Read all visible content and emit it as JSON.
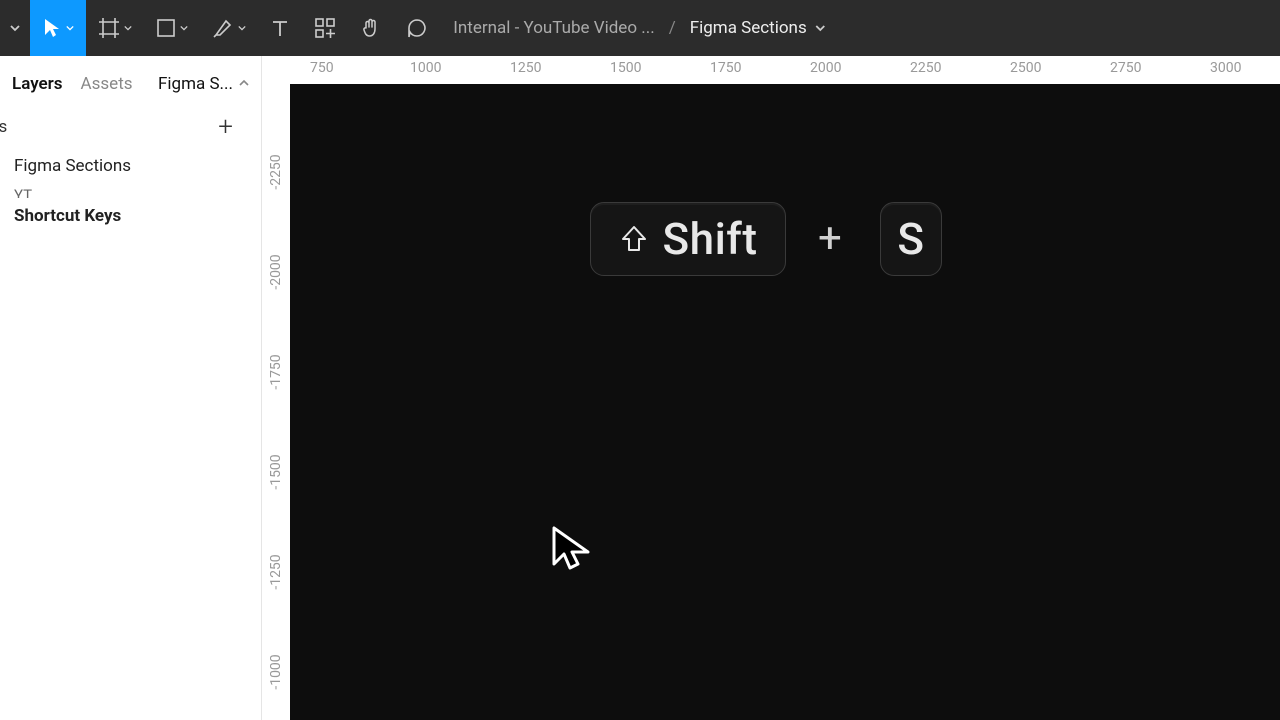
{
  "toolbar": {
    "breadcrumb_project": "Internal - YouTube Video ...",
    "breadcrumb_page": "Figma Sections"
  },
  "sidebar": {
    "tabs": {
      "layers": "Layers",
      "assets": "Assets",
      "page_short": "Figma S..."
    },
    "pages_label": "ges",
    "items": {
      "figma_sections": "Figma Sections",
      "yt": "YT",
      "shortcut_keys": "Shortcut Keys"
    }
  },
  "ruler": {
    "h": [
      "750",
      "1000",
      "1250",
      "1500",
      "1750",
      "2000",
      "2250",
      "2500",
      "2750",
      "3000"
    ],
    "v": [
      "-2250",
      "-2000",
      "-1750",
      "-1500",
      "-1250",
      "-1000"
    ]
  },
  "canvas": {
    "shift_label": "Shift",
    "plus": "+",
    "s_label": "S"
  }
}
